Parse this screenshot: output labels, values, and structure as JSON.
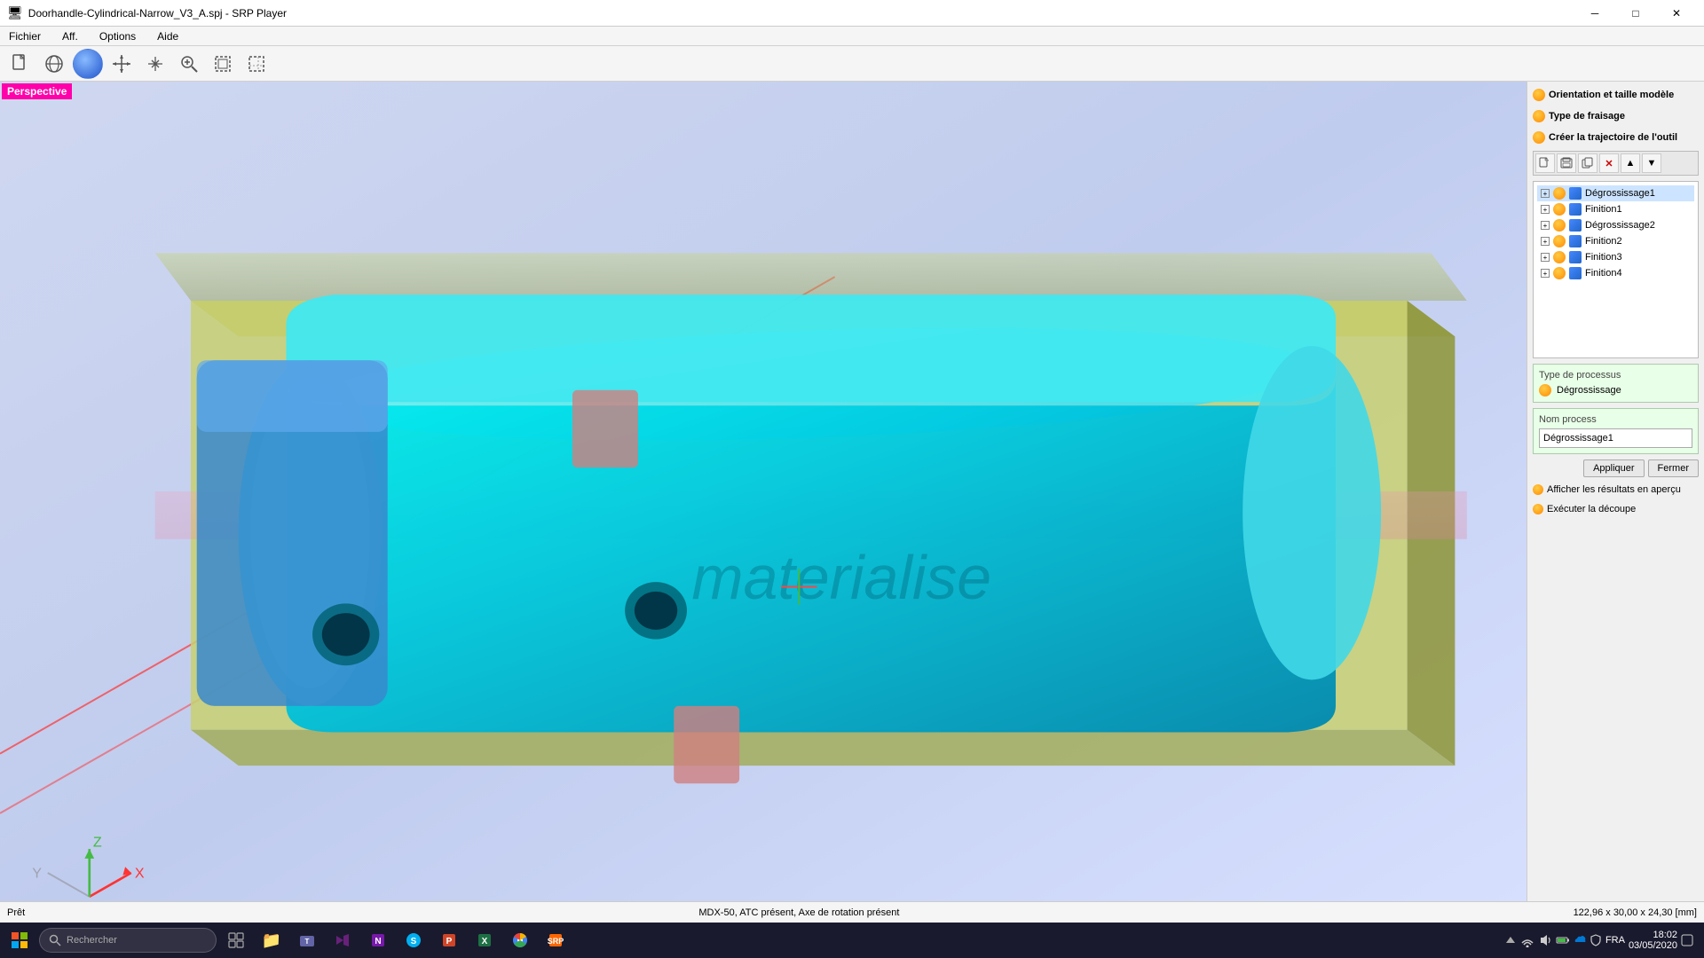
{
  "titlebar": {
    "title": "Doorhandle-Cylindrical-Narrow_V3_A.spj - SRP Player",
    "min": "─",
    "max": "□",
    "close": "✕"
  },
  "menubar": {
    "items": [
      "Fichier",
      "Aff.",
      "Options",
      "Aide"
    ]
  },
  "toolbar": {
    "buttons": [
      {
        "name": "new",
        "icon": "📄"
      },
      {
        "name": "globe",
        "icon": "🌐"
      },
      {
        "name": "sphere",
        "icon": "🔵"
      },
      {
        "name": "move4",
        "icon": "✛"
      },
      {
        "name": "pan",
        "icon": "✥"
      },
      {
        "name": "zoom",
        "icon": "🔍"
      },
      {
        "name": "fit",
        "icon": "⛶"
      },
      {
        "name": "select",
        "icon": "⊠"
      }
    ]
  },
  "viewport": {
    "perspective_label": "Perspective"
  },
  "right_panel": {
    "sections": [
      {
        "label": "Orientation et taille modèle"
      },
      {
        "label": "Type de fraisage"
      },
      {
        "label": "Créer la trajectoire de l'outil"
      }
    ],
    "tree_toolbar_buttons": [
      "📄",
      "💾",
      "📋",
      "✕",
      "▲",
      "▼"
    ],
    "tree_items": [
      {
        "name": "Dégrossissage1",
        "selected": true
      },
      {
        "name": "Finition1",
        "selected": false
      },
      {
        "name": "Dégrossissage2",
        "selected": false
      },
      {
        "name": "Finition2",
        "selected": false
      },
      {
        "name": "Finition3",
        "selected": false
      },
      {
        "name": "Finition4",
        "selected": false
      }
    ],
    "process_type_label": "Type de processus",
    "process_type_value": "Dégrossissage",
    "process_name_label": "Nom process",
    "process_name_value": "Dégrossissage1",
    "apply_btn": "Appliquer",
    "close_btn": "Fermer",
    "preview_link": "Afficher les résultats en aperçu",
    "cut_link": "Exécuter la découpe"
  },
  "statusbar": {
    "left": "Prêt",
    "center": "MDX-50, ATC présent, Axe de rotation présent",
    "right": "122,96 x 30,00 x 24,30 [mm]"
  },
  "taskbar": {
    "time": "18:02",
    "date": "03/05/2020",
    "lang": "FRA",
    "search_placeholder": "Rechercher",
    "apps": [
      "⊞",
      "🔍",
      "⬜",
      "📁",
      "💬",
      "📁",
      "🎯",
      "📘",
      "🔵",
      "🟢",
      "🟠",
      "🦊",
      "🟡"
    ]
  }
}
